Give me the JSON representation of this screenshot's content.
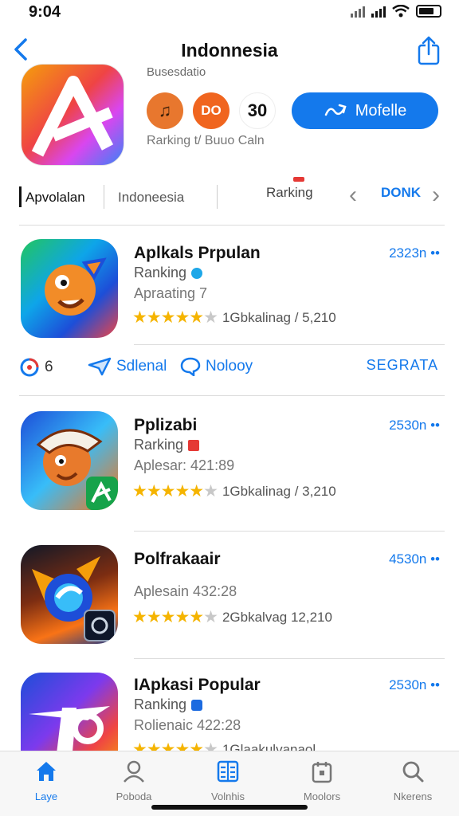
{
  "status": {
    "time": "9:04"
  },
  "nav": {
    "title": "Indonnesia"
  },
  "hero": {
    "subtitle": "Busesdatio",
    "badges": [
      "♫",
      "DO",
      "30"
    ],
    "caption": "Rarking t/ Buuo Caln",
    "primary_button": "Mofelle"
  },
  "tabs": {
    "items": [
      "Apvolalan",
      "Indoneesia",
      "Rarking",
      "DONK"
    ]
  },
  "apps": [
    {
      "name": "Aplkals Prpulan",
      "sub": "Ranking",
      "meta": "Apraating 7",
      "rating_text": "1Gbkalinag / 5,210",
      "size": "2323n ••",
      "stars": 4
    },
    {
      "name": "Pplizabi",
      "sub": "Rarking",
      "meta": "Aplesar: 421:89",
      "rating_text": "1Gbkalinag / 3,210",
      "size": "2530n ••",
      "stars": 4
    },
    {
      "name": "Polfrakaair",
      "sub": "",
      "meta": "Aplesain 432:28",
      "rating_text": "2Gbkalvag 12,210",
      "size": "4530n ••",
      "stars": 4
    },
    {
      "name": "IApkasi Popular",
      "sub": "Ranking",
      "meta": "Rolienaic 422:28",
      "rating_text": "1Glaakulvanaol",
      "size": "2530n ••",
      "stars": 4
    }
  ],
  "actions": {
    "count": "6",
    "share": "Sdlenal",
    "discuss": "Nolooy",
    "right": "SEGRATA"
  },
  "tabbar": {
    "items": [
      "Laye",
      "Poboda",
      "Volnhis",
      "Moolors",
      "Nkerens"
    ]
  },
  "colors": {
    "accent": "#1479ec",
    "star": "#f5b400"
  }
}
